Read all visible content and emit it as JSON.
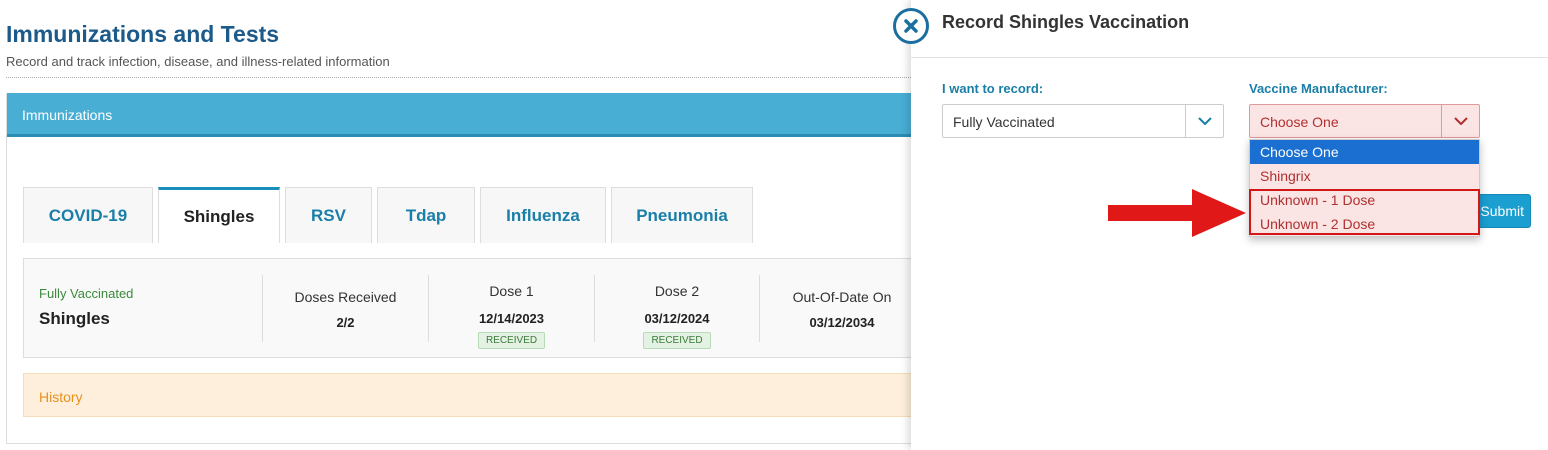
{
  "page": {
    "title": "Immunizations and Tests",
    "subtitle": "Record and track infection, disease, and illness-related information"
  },
  "panel": {
    "header": "Immunizations",
    "tabs": [
      {
        "label": "COVID-19"
      },
      {
        "label": "Shingles"
      },
      {
        "label": "RSV"
      },
      {
        "label": "Tdap"
      },
      {
        "label": "Influenza"
      },
      {
        "label": "Pneumonia"
      }
    ],
    "summary": {
      "status": "Fully Vaccinated",
      "name": "Shingles",
      "doses_label": "Doses Received",
      "doses_value": "2/2",
      "dose1_label": "Dose 1",
      "dose1_date": "12/14/2023",
      "dose1_badge": "RECEIVED",
      "dose2_label": "Dose 2",
      "dose2_date": "03/12/2024",
      "dose2_badge": "RECEIVED",
      "ood_label": "Out-Of-Date On",
      "ood_date": "03/12/2034"
    },
    "history": "History"
  },
  "drawer": {
    "title": "Record Shingles Vaccination",
    "record_label": "I want to record:",
    "record_value": "Fully Vaccinated",
    "manufacturer_label": "Vaccine Manufacturer:",
    "manufacturer_value": "Choose One",
    "manufacturer_options": [
      "Choose One",
      "Shingrix",
      "Unknown - 1 Dose",
      "Unknown - 2 Dose"
    ],
    "submit_label": "Submit"
  },
  "colors": {
    "accent": "#48aed4",
    "title": "#1c5a8a",
    "annotation_red": "#d01818"
  }
}
